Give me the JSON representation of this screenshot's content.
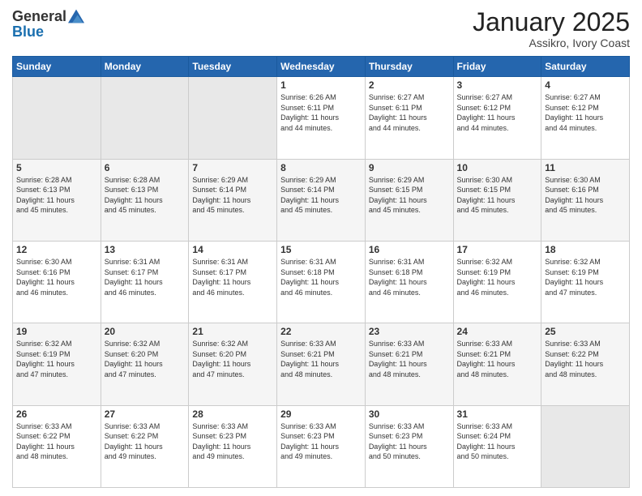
{
  "header": {
    "logo_general": "General",
    "logo_blue": "Blue",
    "month_title": "January 2025",
    "subtitle": "Assikro, Ivory Coast"
  },
  "days_of_week": [
    "Sunday",
    "Monday",
    "Tuesday",
    "Wednesday",
    "Thursday",
    "Friday",
    "Saturday"
  ],
  "weeks": [
    [
      {
        "day": "",
        "info": ""
      },
      {
        "day": "",
        "info": ""
      },
      {
        "day": "",
        "info": ""
      },
      {
        "day": "1",
        "info": "Sunrise: 6:26 AM\nSunset: 6:11 PM\nDaylight: 11 hours\nand 44 minutes."
      },
      {
        "day": "2",
        "info": "Sunrise: 6:27 AM\nSunset: 6:11 PM\nDaylight: 11 hours\nand 44 minutes."
      },
      {
        "day": "3",
        "info": "Sunrise: 6:27 AM\nSunset: 6:12 PM\nDaylight: 11 hours\nand 44 minutes."
      },
      {
        "day": "4",
        "info": "Sunrise: 6:27 AM\nSunset: 6:12 PM\nDaylight: 11 hours\nand 44 minutes."
      }
    ],
    [
      {
        "day": "5",
        "info": "Sunrise: 6:28 AM\nSunset: 6:13 PM\nDaylight: 11 hours\nand 45 minutes."
      },
      {
        "day": "6",
        "info": "Sunrise: 6:28 AM\nSunset: 6:13 PM\nDaylight: 11 hours\nand 45 minutes."
      },
      {
        "day": "7",
        "info": "Sunrise: 6:29 AM\nSunset: 6:14 PM\nDaylight: 11 hours\nand 45 minutes."
      },
      {
        "day": "8",
        "info": "Sunrise: 6:29 AM\nSunset: 6:14 PM\nDaylight: 11 hours\nand 45 minutes."
      },
      {
        "day": "9",
        "info": "Sunrise: 6:29 AM\nSunset: 6:15 PM\nDaylight: 11 hours\nand 45 minutes."
      },
      {
        "day": "10",
        "info": "Sunrise: 6:30 AM\nSunset: 6:15 PM\nDaylight: 11 hours\nand 45 minutes."
      },
      {
        "day": "11",
        "info": "Sunrise: 6:30 AM\nSunset: 6:16 PM\nDaylight: 11 hours\nand 45 minutes."
      }
    ],
    [
      {
        "day": "12",
        "info": "Sunrise: 6:30 AM\nSunset: 6:16 PM\nDaylight: 11 hours\nand 46 minutes."
      },
      {
        "day": "13",
        "info": "Sunrise: 6:31 AM\nSunset: 6:17 PM\nDaylight: 11 hours\nand 46 minutes."
      },
      {
        "day": "14",
        "info": "Sunrise: 6:31 AM\nSunset: 6:17 PM\nDaylight: 11 hours\nand 46 minutes."
      },
      {
        "day": "15",
        "info": "Sunrise: 6:31 AM\nSunset: 6:18 PM\nDaylight: 11 hours\nand 46 minutes."
      },
      {
        "day": "16",
        "info": "Sunrise: 6:31 AM\nSunset: 6:18 PM\nDaylight: 11 hours\nand 46 minutes."
      },
      {
        "day": "17",
        "info": "Sunrise: 6:32 AM\nSunset: 6:19 PM\nDaylight: 11 hours\nand 46 minutes."
      },
      {
        "day": "18",
        "info": "Sunrise: 6:32 AM\nSunset: 6:19 PM\nDaylight: 11 hours\nand 47 minutes."
      }
    ],
    [
      {
        "day": "19",
        "info": "Sunrise: 6:32 AM\nSunset: 6:19 PM\nDaylight: 11 hours\nand 47 minutes."
      },
      {
        "day": "20",
        "info": "Sunrise: 6:32 AM\nSunset: 6:20 PM\nDaylight: 11 hours\nand 47 minutes."
      },
      {
        "day": "21",
        "info": "Sunrise: 6:32 AM\nSunset: 6:20 PM\nDaylight: 11 hours\nand 47 minutes."
      },
      {
        "day": "22",
        "info": "Sunrise: 6:33 AM\nSunset: 6:21 PM\nDaylight: 11 hours\nand 48 minutes."
      },
      {
        "day": "23",
        "info": "Sunrise: 6:33 AM\nSunset: 6:21 PM\nDaylight: 11 hours\nand 48 minutes."
      },
      {
        "day": "24",
        "info": "Sunrise: 6:33 AM\nSunset: 6:21 PM\nDaylight: 11 hours\nand 48 minutes."
      },
      {
        "day": "25",
        "info": "Sunrise: 6:33 AM\nSunset: 6:22 PM\nDaylight: 11 hours\nand 48 minutes."
      }
    ],
    [
      {
        "day": "26",
        "info": "Sunrise: 6:33 AM\nSunset: 6:22 PM\nDaylight: 11 hours\nand 48 minutes."
      },
      {
        "day": "27",
        "info": "Sunrise: 6:33 AM\nSunset: 6:22 PM\nDaylight: 11 hours\nand 49 minutes."
      },
      {
        "day": "28",
        "info": "Sunrise: 6:33 AM\nSunset: 6:23 PM\nDaylight: 11 hours\nand 49 minutes."
      },
      {
        "day": "29",
        "info": "Sunrise: 6:33 AM\nSunset: 6:23 PM\nDaylight: 11 hours\nand 49 minutes."
      },
      {
        "day": "30",
        "info": "Sunrise: 6:33 AM\nSunset: 6:23 PM\nDaylight: 11 hours\nand 50 minutes."
      },
      {
        "day": "31",
        "info": "Sunrise: 6:33 AM\nSunset: 6:24 PM\nDaylight: 11 hours\nand 50 minutes."
      },
      {
        "day": "",
        "info": ""
      }
    ]
  ]
}
